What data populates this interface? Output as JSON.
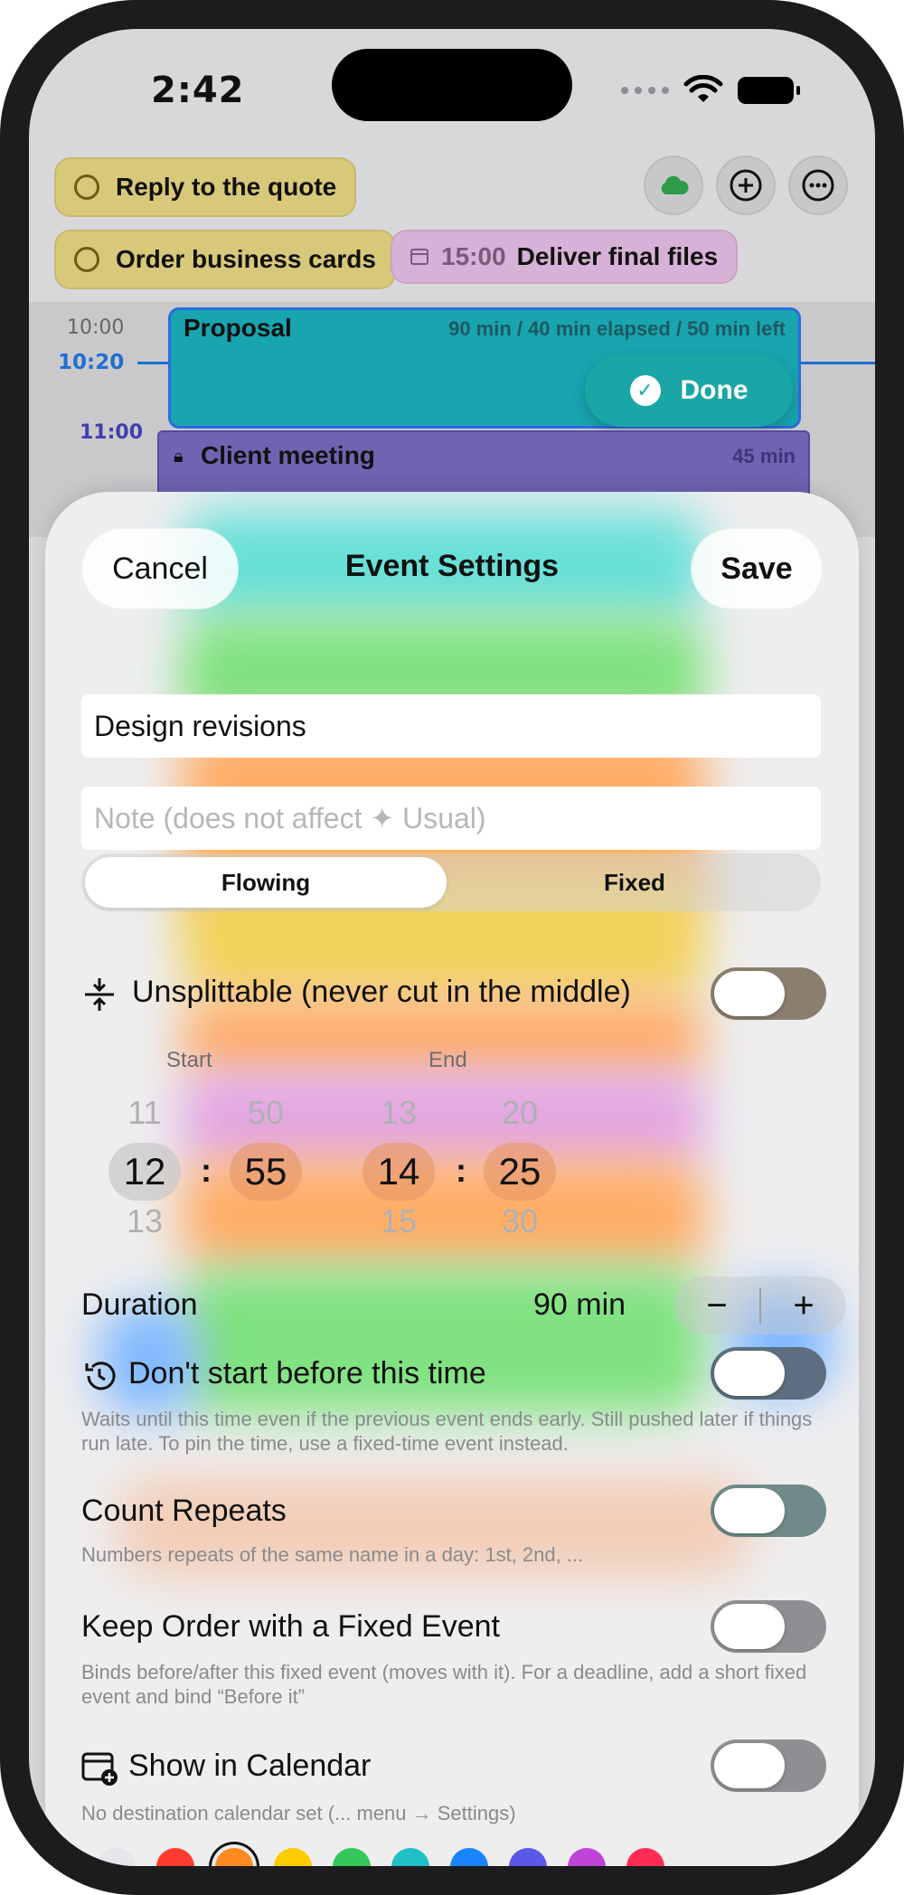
{
  "status_bar": {
    "time": "2:42"
  },
  "top_bar": {
    "tasks": [
      {
        "label": "Reply to the quote"
      },
      {
        "label": "Order business cards"
      }
    ],
    "deadline": {
      "time": "15:00",
      "label": "Deliver final files"
    },
    "buttons": {
      "cloud": "cloud-icon",
      "add": "plus-icon",
      "more": "ellipsis-icon"
    }
  },
  "timeline": {
    "times": [
      "10:00",
      "10:20",
      "11:00"
    ],
    "events": [
      {
        "title": "Proposal",
        "meta": "90 min / 40 min elapsed / 50 min left",
        "color": "#18a5b0"
      },
      {
        "title": "Client meeting",
        "meta": "45 min",
        "color": "#6f63b2"
      }
    ],
    "done_label": "Done"
  },
  "sheet": {
    "cancel": "Cancel",
    "title": "Event Settings",
    "save": "Save",
    "name_value": "Design revisions",
    "note_placeholder": "Note (does not affect ✦ Usual)",
    "segment": {
      "selected": "Flowing",
      "other": "Fixed"
    },
    "unsplittable_label": "Unsplittable (never cut in the middle)",
    "unsplittable_on": false,
    "start_label": "Start",
    "end_label": "End",
    "start": {
      "hour_prev": "11",
      "hour": "12",
      "hour_next": "13",
      "min_prev": "50",
      "min": "55",
      "min_next": ""
    },
    "end": {
      "hour_prev": "13",
      "hour": "14",
      "hour_next": "15",
      "min_prev": "20",
      "min": "25",
      "min_next": "30"
    },
    "duration_label": "Duration",
    "duration_value": "90 min",
    "stepper": {
      "minus": "−",
      "plus": "+"
    },
    "dont_start_label": "Don't start before this time",
    "dont_start_desc": "Waits until this time even if the previous event ends early. Still pushed later if things run late. To pin the time, use a fixed-time event instead.",
    "count_repeats_label": "Count Repeats",
    "count_repeats_desc": "Numbers repeats of the same name in a day: 1st, 2nd, ...",
    "keep_order_label": "Keep Order with a Fixed Event",
    "keep_order_desc": "Binds before/after this fixed event (moves with it). For a deadline, add a short fixed event and bind “Before it”",
    "calendar_label": "Show in Calendar",
    "calendar_desc": "No destination calendar set (... menu → Settings)",
    "colors": [
      "#e5e5ea",
      "#ff3b30",
      "#ff8a1f",
      "#ffcc00",
      "#34c759",
      "#1fc0c6",
      "#1a84ff",
      "#5b57e8",
      "#c043d8",
      "#ff2d55"
    ],
    "selected_color": "#ff8a1f"
  }
}
